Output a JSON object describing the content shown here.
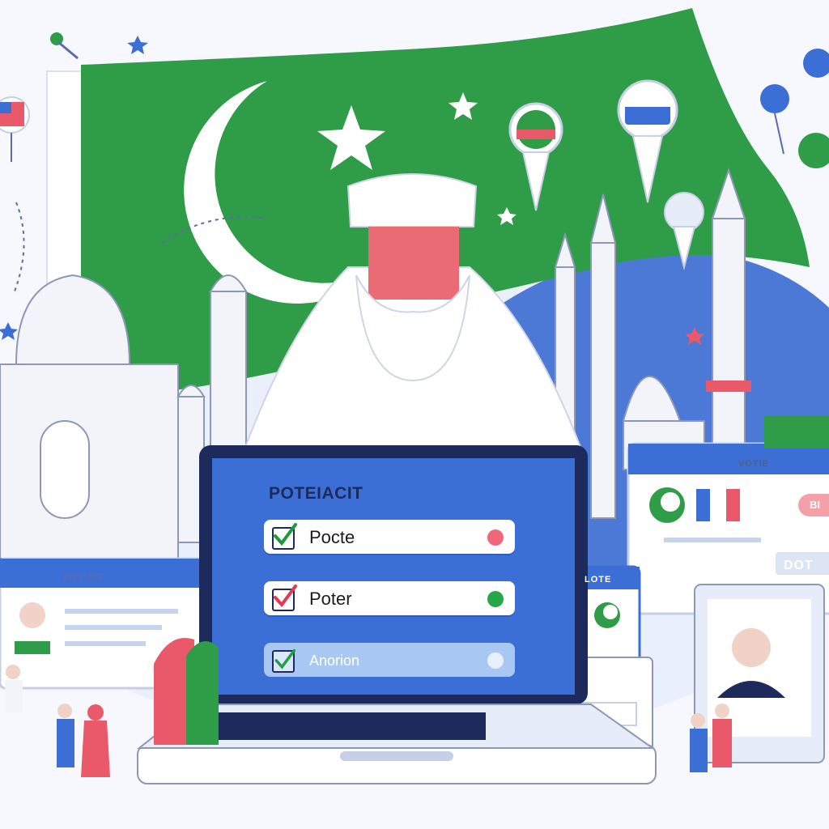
{
  "laptop": {
    "title": "POTEIACIT",
    "options": [
      {
        "label": "Pocte",
        "checked": true,
        "check_color": "#1f9a3a",
        "dot_color": "#f0677a"
      },
      {
        "label": "Poter",
        "checked": true,
        "check_color": "#e5394f",
        "dot_color": "#25a745"
      },
      {
        "label": "Anorion",
        "checked": true,
        "check_color": "#22a045",
        "dot_color": "#e9f1ff"
      }
    ]
  },
  "left_panel": {
    "title": "VOTING"
  },
  "right_panel": {
    "title": "VOTIE",
    "pill": "BI",
    "button": "DOT"
  },
  "ballot_card": {
    "title": "LOTE"
  },
  "colors": {
    "flag_green": "#2e9c47",
    "screen_blue": "#3b6fd6",
    "accent_red": "#e9596a",
    "navy": "#1d2b5c"
  },
  "icons": [
    "crescent-star-icon",
    "checkmark-icon",
    "map-pin-icon",
    "star-icon"
  ]
}
